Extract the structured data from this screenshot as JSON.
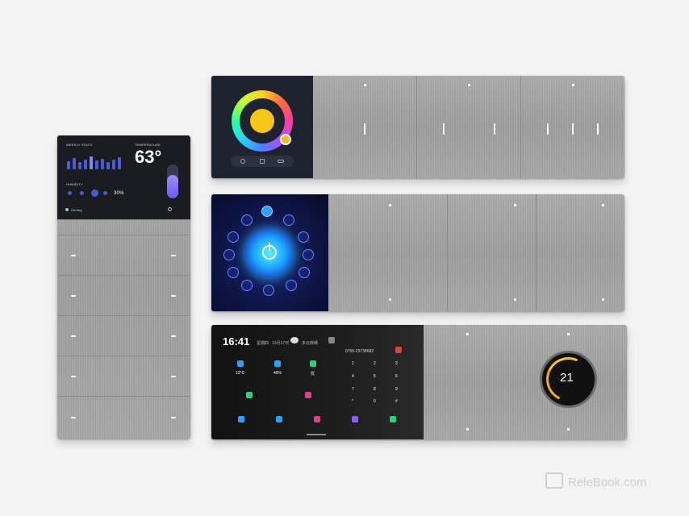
{
  "left_panel": {
    "weekly_stats_label": "WEEKLY STATS",
    "temperature_label": "TEMPERATURE",
    "temperature_value": "63°",
    "humidity_label": "HUMIDITY",
    "humidity_value": "30%",
    "status_text": "Setting"
  },
  "bottom_panel": {
    "time": "16:41",
    "date": "10月17日",
    "weekday": "星期四",
    "weather": "多云转晴",
    "phone": "0755-23738682",
    "tile_temp": "13°C",
    "tile_humidity": "46%",
    "tile_air": "优",
    "keypad": [
      "1",
      "2",
      "3",
      "4",
      "5",
      "6",
      "7",
      "8",
      "9",
      "*",
      "0",
      "#"
    ],
    "thermostat_value": "21"
  },
  "watermark": "RelеBook.com",
  "colors": {
    "wall": "#f3f3f3",
    "metal": "#a3a3a3",
    "screen_dark": "#1a1c22",
    "accent_blue": "#2bb6ff",
    "accent_yellow": "#f5c518"
  }
}
